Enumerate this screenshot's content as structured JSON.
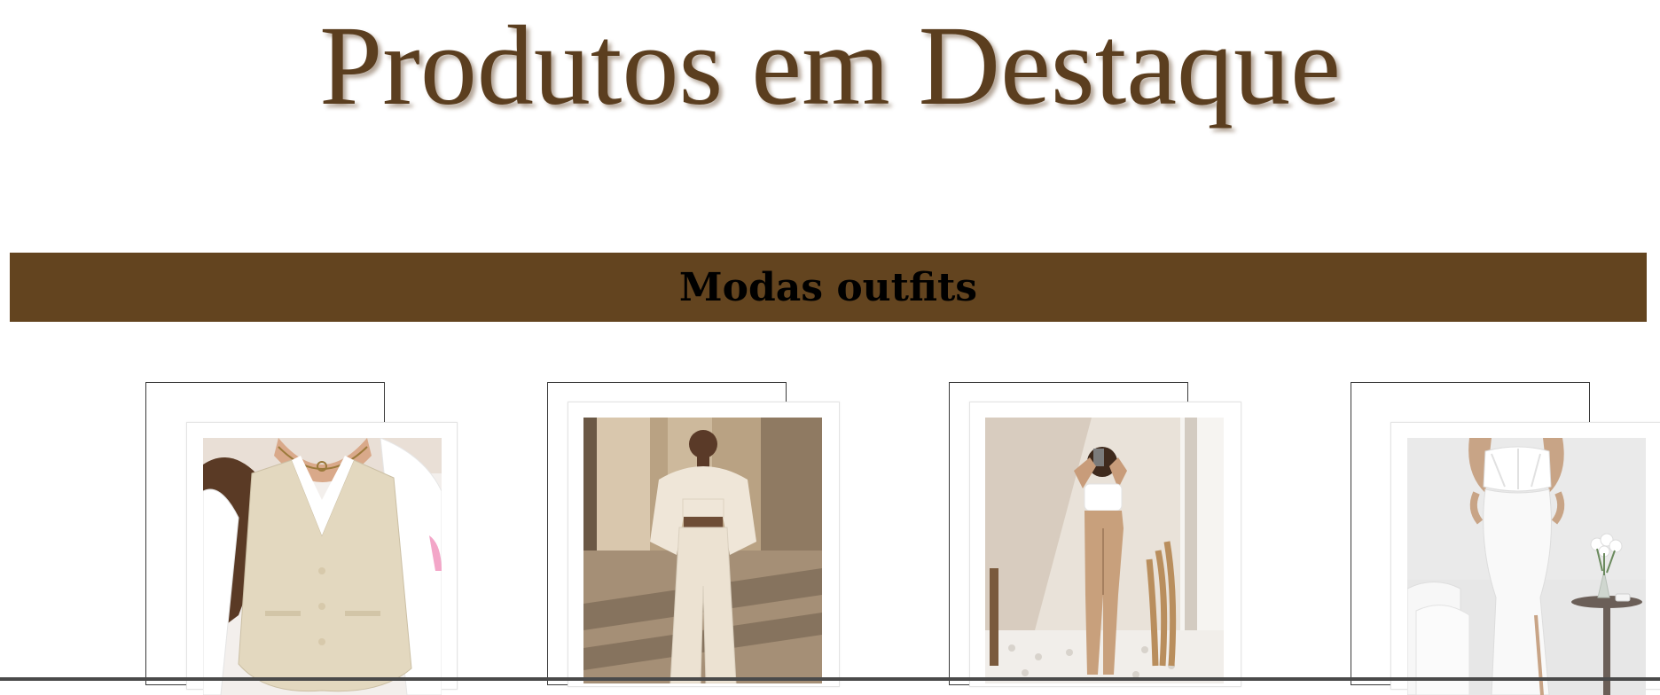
{
  "header": {
    "title": "Produtos em Destaque"
  },
  "section": {
    "title": "Modas outfits"
  },
  "products": [
    {
      "image": "beige-vest-white-shirt-photo"
    },
    {
      "image": "cream-cropped-outfit-photo"
    },
    {
      "image": "white-top-tan-pants-photo"
    },
    {
      "image": "white-corset-dress-photo"
    }
  ],
  "colors": {
    "title_text": "#5b3e1f",
    "band_background": "#63441f",
    "band_text": "#000000",
    "page_background": "#ffffff"
  }
}
